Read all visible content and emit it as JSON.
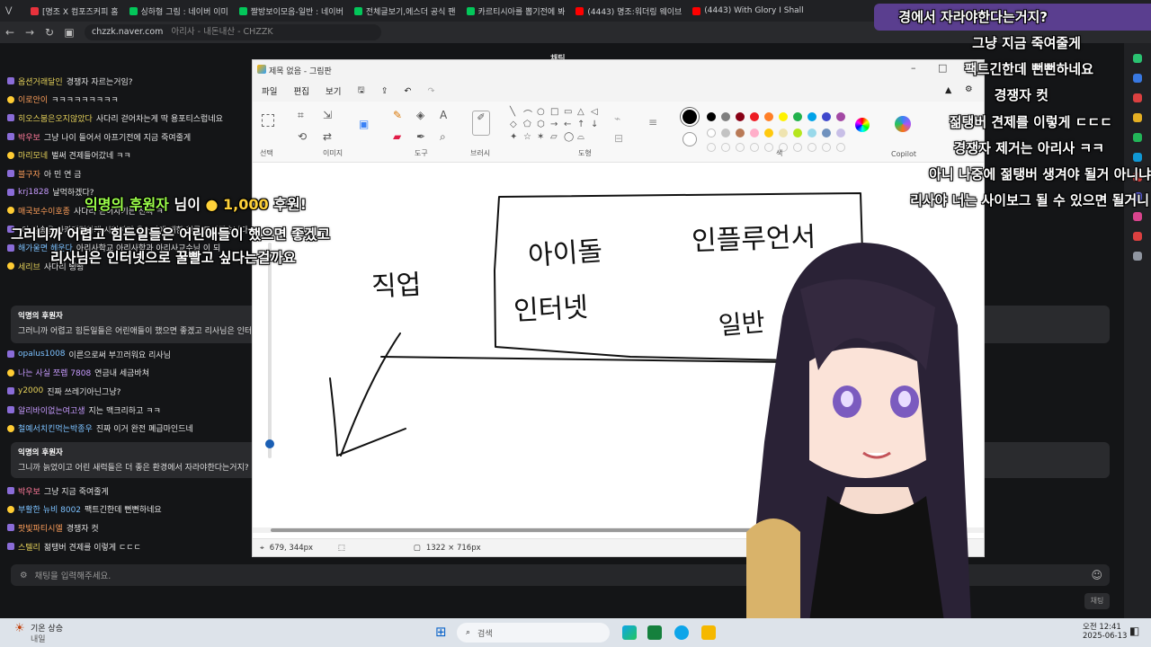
{
  "browser": {
    "tabs": [
      {
        "label": "[명조 X 컴포즈커피 홈",
        "color": "#e8323c"
      },
      {
        "label": "싱하형 그림 : 네이버 이미",
        "color": "#03c75a"
      },
      {
        "label": "짤방보이모음-일반 : 네이버",
        "color": "#03c75a"
      },
      {
        "label": "전체글보기,에스더 공식 팬",
        "color": "#03c75a"
      },
      {
        "label": "카르티시아를 뽑기전에 봐",
        "color": "#03c75a"
      },
      {
        "label": "(4443) 명조:워더링 웨이브",
        "color": "#ff0000"
      },
      {
        "label": "(4443) With Glory I Shall R",
        "color": "#ff0000"
      }
    ],
    "url": "chzzk.naver.com",
    "url_rest": "아리사 - 내돈내산 - CHZZK"
  },
  "chat": {
    "messages": [
      {
        "nick": "옵션거래달인",
        "text": "경쟁자 자르는거임?",
        "cls": "y"
      },
      {
        "nick": "이로안이",
        "text": "ㅋㅋㅋㅋㅋㅋㅋㅋㅋ",
        "cls": "o"
      },
      {
        "nick": "히오스붐은오지않았다",
        "text": "사다리 걷어차는게 딱 용포티스럽네요",
        "cls": "y"
      },
      {
        "nick": "박우보",
        "text": "그냥 나이 들어서 아프기전에 지금 죽여줄게",
        "cls": "r"
      },
      {
        "nick": "마리모네",
        "text": "벌써 견제들어갔네 ㅋㅋ",
        "cls": "y"
      },
      {
        "nick": "블구자",
        "text": "아 민 연 금",
        "cls": "o"
      },
      {
        "nick": "krj1828",
        "text": "날먹하겠다?",
        "cls": "p"
      },
      {
        "nick": "매국보수이호종",
        "text": "사다리 걷어차기는 진짜 ㅋ",
        "cls": "o"
      },
      {
        "nick": "",
        "text": "이 방송을 아카데믹하게 시청하던 유스비에 대한 천류 드리겠습니다",
        "cls": ""
      },
      {
        "nick": "해가울면 헤운다",
        "text": "아리사학교 아리사학과 아리사교수님 이 되",
        "cls": "g"
      },
      {
        "nick": "세리브",
        "text": "사다리 뻥뻥",
        "cls": "y"
      }
    ],
    "messages2": [
      {
        "nick": "opalus1008",
        "text": "이른으로써 부끄러워요 리사님",
        "cls": "g"
      },
      {
        "nick": "나는 사실 쪼렙 7808",
        "text": "연금내 세금바쳐",
        "cls": "p"
      },
      {
        "nick": "y2000",
        "text": "진짜 쓰레기아닌그냥?",
        "cls": "y"
      },
      {
        "nick": "알리바이없는여고생",
        "text": "지는 맥크리하고 ㅋㅋ",
        "cls": "p"
      },
      {
        "nick": "철예서치킨먹는박종우",
        "text": "진짜 이거 완전 폐급마인드네",
        "cls": "g"
      }
    ],
    "messages3": [
      {
        "nick": "박우보",
        "text": "그냥 지금 죽여줄게",
        "cls": "r"
      },
      {
        "nick": "부활한 뉴비 8002",
        "text": "팩트긴한데 뻔뻔하네요",
        "cls": "g"
      },
      {
        "nick": "팟빛파티시엘",
        "text": "경쟁자 컷",
        "cls": "o"
      },
      {
        "nick": "스텔리",
        "text": "젊탱버 견제를 이렇게 ㄷㄷㄷ",
        "cls": "y"
      }
    ],
    "donation_box1": {
      "title": "익명의 후원자",
      "body": "그러니까 어렵고 힘든일들은 어린애들이 했으면 좋겠고 리사님은 인터넷으로 꿀빨고 싶다는걸까요"
    },
    "donation_box2": {
      "title": "익명의 후원자",
      "body": "그니까 늙었이고 어린 새럭들은 더 좋은 환경에서 자라야한다는거지?"
    },
    "input_placeholder": "채팅을 입력해주세요.",
    "send_label": "채팅"
  },
  "header_label": "채팅",
  "paint": {
    "title": "제목 없음 - 그림판",
    "menu": [
      "파일",
      "편집",
      "보기"
    ],
    "groups": [
      "선택",
      "이미지",
      "도구",
      "브러시",
      "도형",
      "색",
      "Copilot"
    ],
    "status_pos": "679, 344px",
    "status_size": "1322 × 716px",
    "palette": [
      "#000000",
      "#7f7f7f",
      "#880015",
      "#ed1c24",
      "#ff7f27",
      "#fff200",
      "#22b14c",
      "#00a2e8",
      "#3f48cc",
      "#a349a4"
    ],
    "palette2": [
      "#ffffff",
      "#c3c3c3",
      "#b97a57",
      "#ffaec9",
      "#ffc90e",
      "#efe4b0",
      "#b5e61d",
      "#99d9ea",
      "#7092be",
      "#c8bfe7"
    ],
    "sketch_labels": [
      "직업",
      "아이돌",
      "인플루언서",
      "인터넷",
      "일반"
    ]
  },
  "donation_alert": {
    "name": "익명의 후원자",
    "mid": "님이",
    "amount": "1,000",
    "suffix": "후원!"
  },
  "alert_message": [
    "그러니까 어렵고 힘든일들은 어린애들이 했으면 좋겠고",
    "리사님은 인터넷으로 꿀빨고 싶다는걸까요"
  ],
  "overlay_chat": [
    "경에서 자라야한다는거지?",
    "그냥 지금 죽여줄게",
    "팩트긴한데 뻔뻔하네요",
    "경쟁자 컷",
    "젊탱버 견제를 이렇게 ㄷㄷㄷ",
    "경쟁자 제거는 아리사 ㅋㅋ",
    "아니 나중에 젊탱버 생겨야 될거 아니냐",
    "리사야 너는 사이보그 될 수 있으면 될거니"
  ],
  "taskbar": {
    "weather": "기온 상승",
    "weather_sub": "내일",
    "search": "검색",
    "time": "오전 12:41",
    "date": "2025-06-13"
  }
}
